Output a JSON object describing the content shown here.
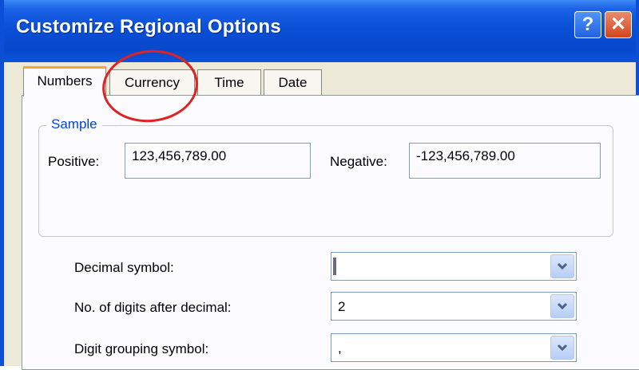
{
  "window": {
    "title": "Customize Regional Options",
    "help_label": "?",
    "close_label": "✕"
  },
  "tabs": [
    {
      "label": "Numbers",
      "active": true
    },
    {
      "label": "Currency",
      "active": false,
      "annotated": true
    },
    {
      "label": "Time",
      "active": false
    },
    {
      "label": "Date",
      "active": false
    }
  ],
  "sample": {
    "legend": "Sample",
    "positive_label": "Positive:",
    "positive_value": "123,456,789.00",
    "negative_label": "Negative:",
    "negative_value": "-123,456,789.00"
  },
  "settings": [
    {
      "label": "Decimal symbol:",
      "value": ""
    },
    {
      "label": "No. of digits after decimal:",
      "value": "2"
    },
    {
      "label": "Digit grouping symbol:",
      "value": ","
    }
  ],
  "colors": {
    "titlebar": "#0a4fd6",
    "active_tab_accent": "#f0a83c",
    "legend_text": "#0046d5",
    "annotation_circle": "#e02222",
    "close_button": "#d2461c"
  },
  "icons": {
    "help": "question-mark-icon",
    "close": "close-icon",
    "dropdown": "chevron-down-icon"
  }
}
